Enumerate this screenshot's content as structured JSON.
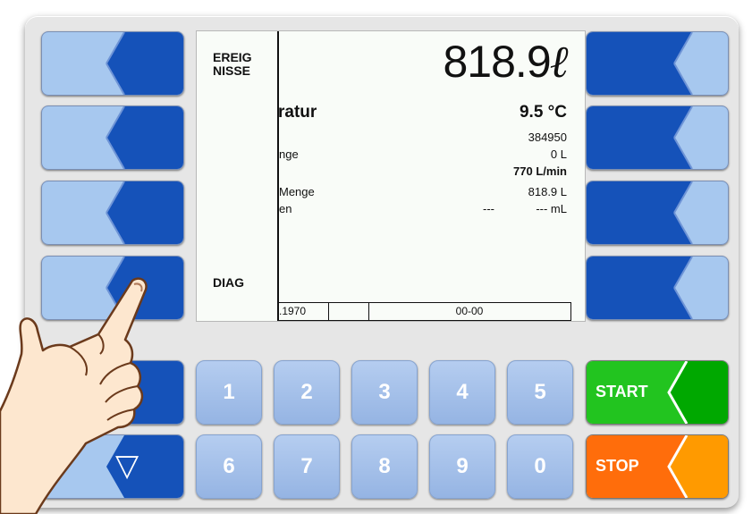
{
  "display": {
    "big_value": "818.9",
    "big_unit": "ℓ",
    "side_labels": {
      "events_line1": "EREIG",
      "events_line2": "NISSE",
      "diag": "DIAG"
    },
    "temperature_label": "ratur",
    "temperature_value": "9.5 °C",
    "rows": {
      "number_value": "384950",
      "menge_label": "nge",
      "menge_value": "0 L",
      "flow_value": "770 L/min",
      "total_label": "Menge",
      "total_value": "818.9 L",
      "en_label": "en",
      "en_value_1": "---",
      "en_value_2": "--- mL"
    },
    "status": {
      "date": ".1970",
      "code": "00-00"
    }
  },
  "keypad": {
    "row1": [
      "1",
      "2",
      "3",
      "4",
      "5"
    ],
    "row2": [
      "6",
      "7",
      "8",
      "9",
      "0"
    ]
  },
  "buttons": {
    "start": "START",
    "stop": "STOP",
    "down_arrow": "▽"
  },
  "colors": {
    "softkey_light": "#a7c8ef",
    "softkey_dark": "#1552b9",
    "start": "#22c41f",
    "stop": "#ff6d0b",
    "stop_light": "#ff9a00",
    "start_dark": "#00a800"
  }
}
